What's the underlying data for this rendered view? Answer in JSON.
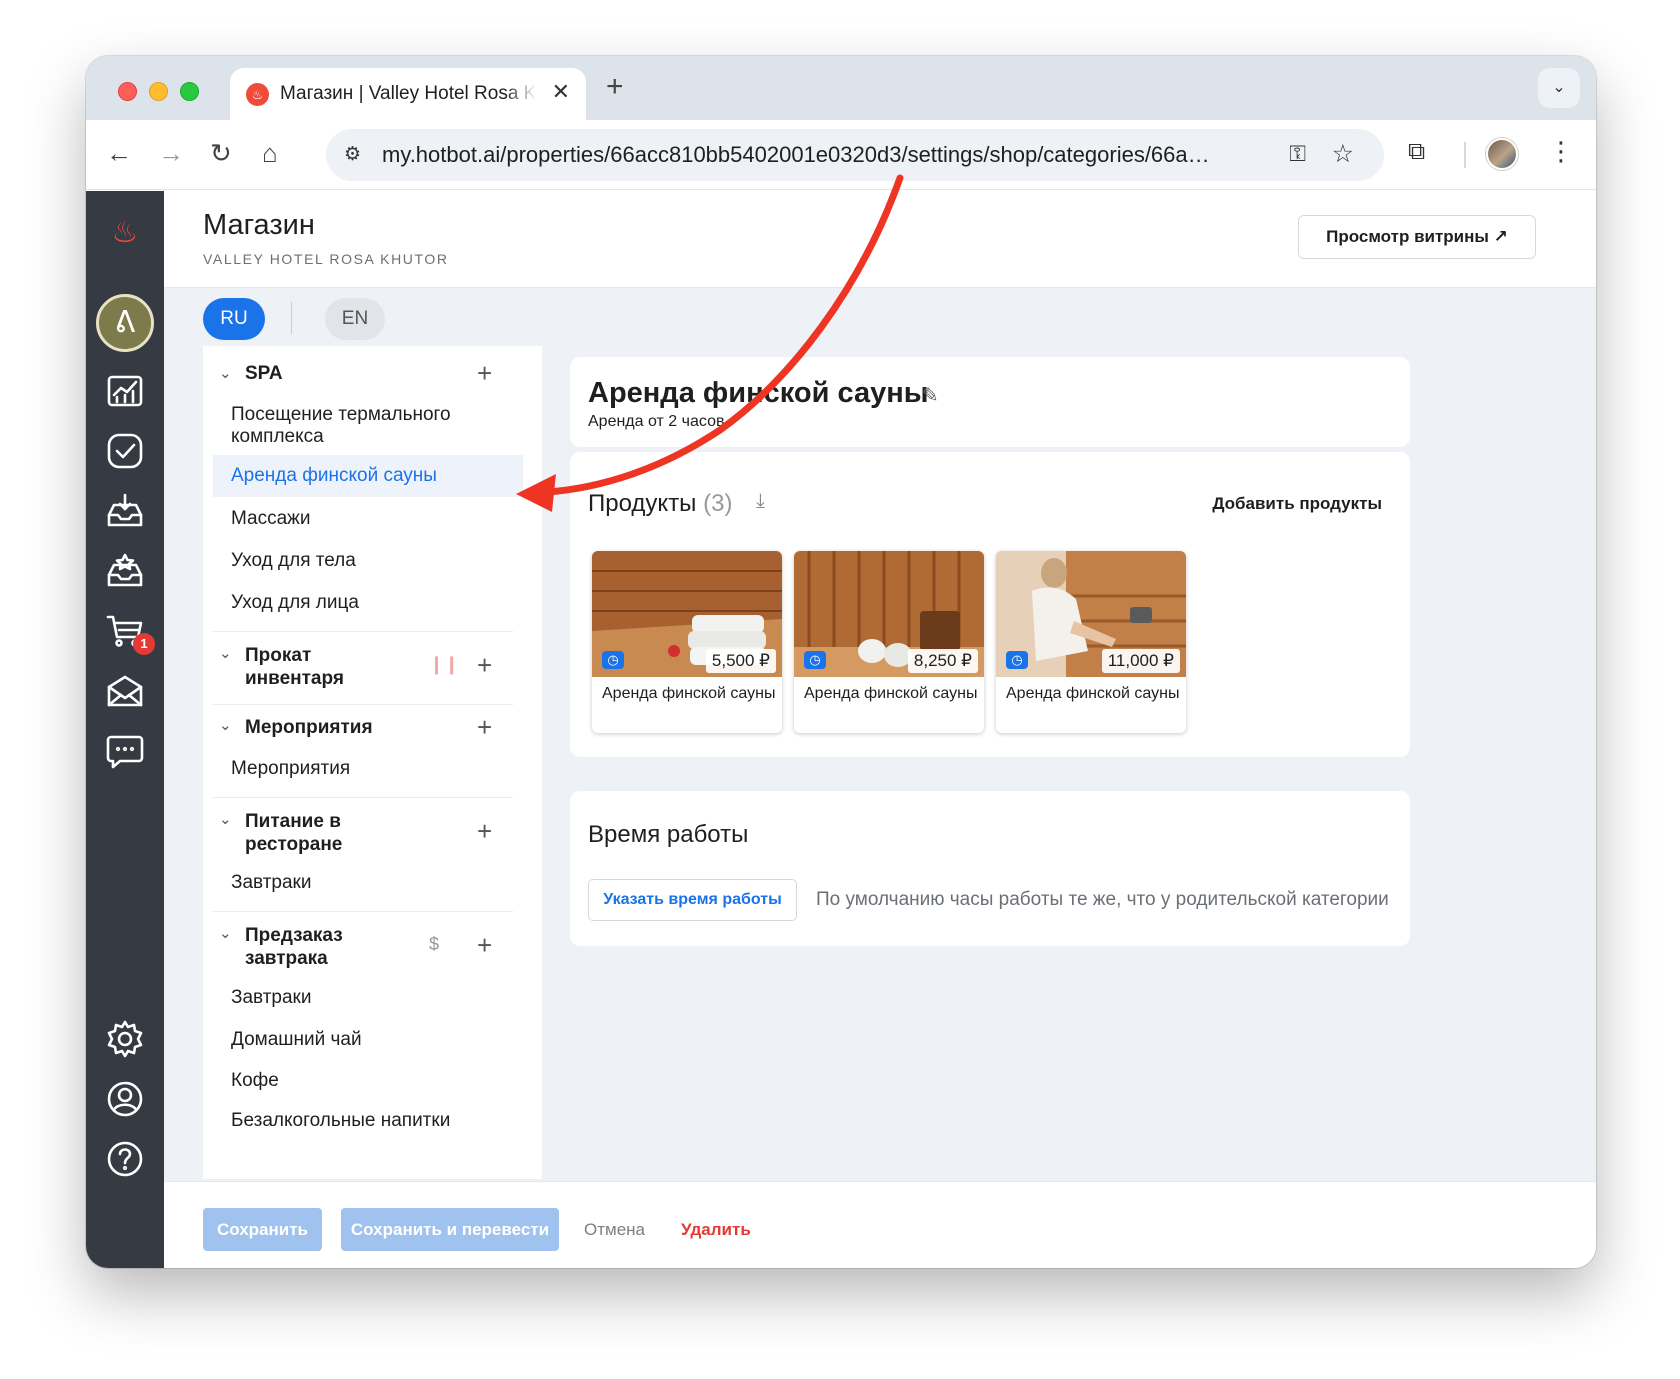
{
  "browser": {
    "tab_title": "Магазин | Valley Hotel Rosa Khutor",
    "tab_close": "✕",
    "new_tab": "+",
    "url_host": "my.hotbot.ai",
    "url_path": "/properties/66acc810bb5402001e0320d3/settings/shop/categories/66a…",
    "icons": [
      "back-icon",
      "forward-icon",
      "reload-icon",
      "home-icon",
      "site-settings-icon",
      "key-icon",
      "star-icon",
      "extensions-icon",
      "profile-avatar",
      "menu-icon"
    ]
  },
  "header": {
    "title": "Магазин",
    "subtitle": "VALLEY HOTEL ROSA KHUTOR",
    "preview_button": "Просмотр витрины ↗"
  },
  "languages": {
    "active": "RU",
    "other": "EN"
  },
  "sidebar_nav": {
    "cart_badge": "1"
  },
  "categories": [
    {
      "name": "SPA",
      "items": [
        "Посещение термального комплекса",
        "Аренда финской сауны",
        "Массажи",
        "Уход для тела",
        "Уход для лица"
      ],
      "active_item": "Аренда финской сауны"
    },
    {
      "name": "Прокат инвентаря",
      "mark": "pause-icon",
      "items": []
    },
    {
      "name": "Мероприятия",
      "items": [
        "Мероприятия"
      ]
    },
    {
      "name": "Питание в ресторане",
      "items": [
        "Завтраки"
      ]
    },
    {
      "name": "Предзаказ завтрака",
      "mark": "$",
      "items": [
        "Завтраки",
        "Домашний чай",
        "Кофе",
        "Безалкогольные напитки"
      ]
    }
  ],
  "category": {
    "title": "Аренда финской сауны",
    "description": "Аренда от 2 часов."
  },
  "products": {
    "heading": "Продукты",
    "count": "(3)",
    "add_label": "Добавить продукты",
    "items": [
      {
        "name": "Аренда финской сауны",
        "price": "5,500 ₽"
      },
      {
        "name": "Аренда финской сауны",
        "price": "8,250 ₽"
      },
      {
        "name": "Аренда финской сауны",
        "price": "11,000 ₽"
      }
    ]
  },
  "hours": {
    "title": "Время работы",
    "button": "Указать время работы",
    "note": "По умолчанию часы работы те же, что у родительской категории"
  },
  "footer": {
    "save": "Сохранить",
    "save_translate": "Сохранить и перевести",
    "cancel": "Отмена",
    "delete": "Удалить"
  },
  "colors": {
    "accent": "#1a73e8",
    "sidebar": "#353a43",
    "annotation_arrow": "#ee3524",
    "danger": "#e53935"
  }
}
